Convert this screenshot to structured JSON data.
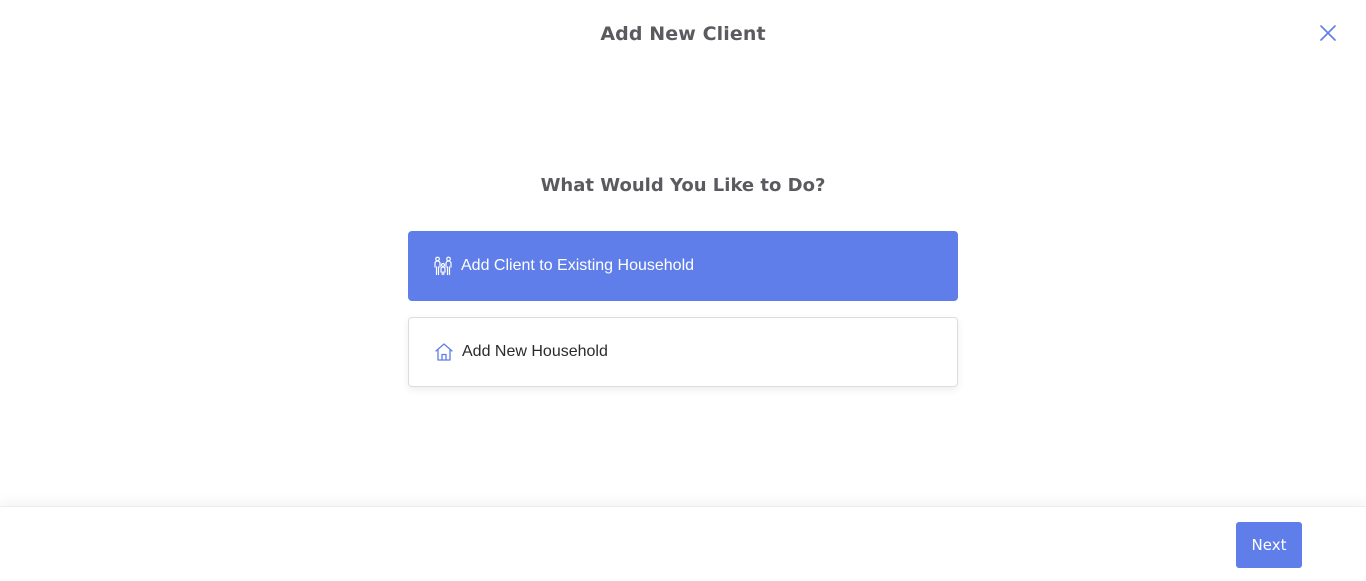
{
  "modal": {
    "title": "Add New Client",
    "close_icon": "close-icon"
  },
  "prompt": {
    "question": "What Would You Like to Do?"
  },
  "options": [
    {
      "label": "Add Client to Existing Household",
      "icon": "family-icon",
      "selected": true
    },
    {
      "label": "Add New Household",
      "icon": "home-icon",
      "selected": false
    }
  ],
  "footer": {
    "next_label": "Next"
  },
  "colors": {
    "accent": "#5f7ee9",
    "title_text": "#5b5b5f",
    "option_text": "#2a2a2e",
    "close_icon": "#5f7ee9"
  }
}
